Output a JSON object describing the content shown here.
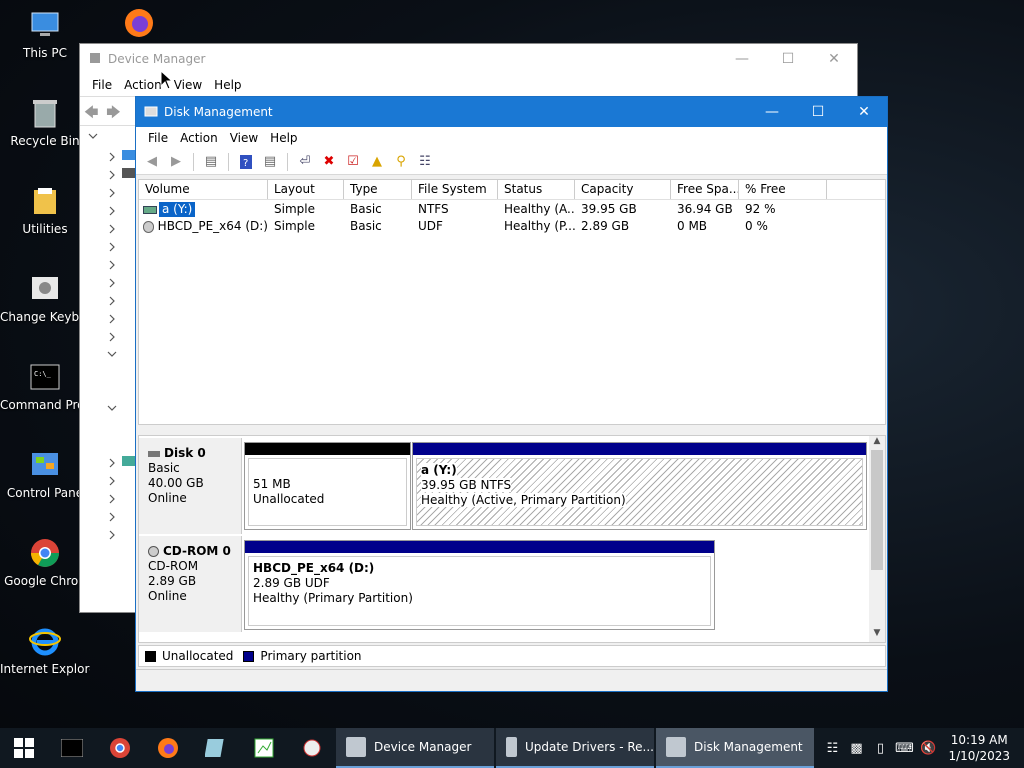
{
  "desktop": {
    "icons": [
      {
        "label": "This PC"
      },
      {
        "label": "Recycle Bin"
      },
      {
        "label": "Utilities"
      },
      {
        "label": "Change Keyboard Layo"
      },
      {
        "label": "Command Prompt"
      },
      {
        "label": "Control Pane"
      },
      {
        "label": "Google Chron"
      },
      {
        "label": "Internet Explorer"
      }
    ]
  },
  "device_manager": {
    "title": "Device Manager",
    "menu": [
      "File",
      "Action",
      "View",
      "Help"
    ]
  },
  "disk_management": {
    "title": "Disk Management",
    "menu": [
      "File",
      "Action",
      "View",
      "Help"
    ],
    "columns": [
      "Volume",
      "Layout",
      "Type",
      "File System",
      "Status",
      "Capacity",
      "Free Spa...",
      "% Free"
    ],
    "volumes": [
      {
        "volume": "a (Y:)",
        "layout": "Simple",
        "type": "Basic",
        "fs": "NTFS",
        "status": "Healthy (A...",
        "capacity": "39.95 GB",
        "free": "36.94 GB",
        "pct": "92 %"
      },
      {
        "volume": "HBCD_PE_x64 (D:)",
        "layout": "Simple",
        "type": "Basic",
        "fs": "UDF",
        "status": "Healthy (P...",
        "capacity": "2.89 GB",
        "free": "0 MB",
        "pct": "0 %"
      }
    ],
    "disks": [
      {
        "name": "Disk 0",
        "kind": "Basic",
        "size": "40.00 GB",
        "state": "Online",
        "unalloc_size": "51 MB",
        "unalloc_label": "Unallocated",
        "part_name": "a  (Y:)",
        "part_size": "39.95 GB NTFS",
        "part_status": "Healthy (Active, Primary Partition)"
      },
      {
        "name": "CD-ROM 0",
        "kind": "CD-ROM",
        "size": "2.89 GB",
        "state": "Online",
        "part_name": "HBCD_PE_x64  (D:)",
        "part_size": "2.89 GB UDF",
        "part_status": "Healthy (Primary Partition)"
      }
    ],
    "legend": {
      "unallocated": "Unallocated",
      "primary": "Primary partition"
    }
  },
  "taskbar": {
    "buttons": [
      "Device Manager",
      "Update Drivers - Re...",
      "Disk Management"
    ],
    "time": "10:19 AM",
    "date": "1/10/2023"
  },
  "colors": {
    "primary_partition": "#00008b",
    "unallocated": "#000000",
    "title_active": "#1a78d4"
  }
}
